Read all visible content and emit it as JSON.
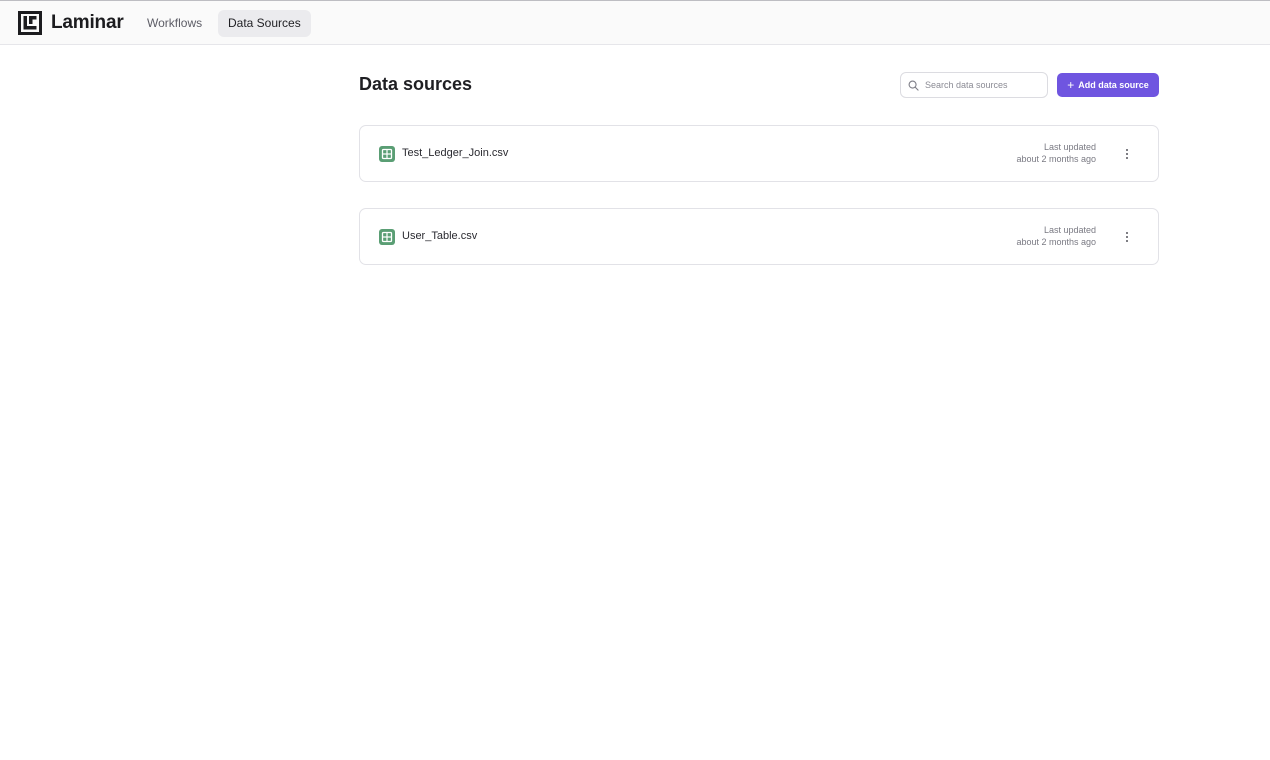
{
  "app": {
    "name": "Laminar"
  },
  "nav": {
    "tabs": [
      {
        "label": "Workflows",
        "active": false
      },
      {
        "label": "Data Sources",
        "active": true
      }
    ]
  },
  "page": {
    "title": "Data sources"
  },
  "search": {
    "placeholder": "Search data sources",
    "value": ""
  },
  "actions": {
    "add_label": "Add data source",
    "add_color": "#6f55e0"
  },
  "data_sources": [
    {
      "name": "Test_Ledger_Join.csv",
      "updated_label": "Last updated",
      "updated_value": "about 2 months ago",
      "icon": "spreadsheet-icon",
      "icon_color": "#5a9e74"
    },
    {
      "name": "User_Table.csv",
      "updated_label": "Last updated",
      "updated_value": "about 2 months ago",
      "icon": "spreadsheet-icon",
      "icon_color": "#5a9e74"
    }
  ]
}
